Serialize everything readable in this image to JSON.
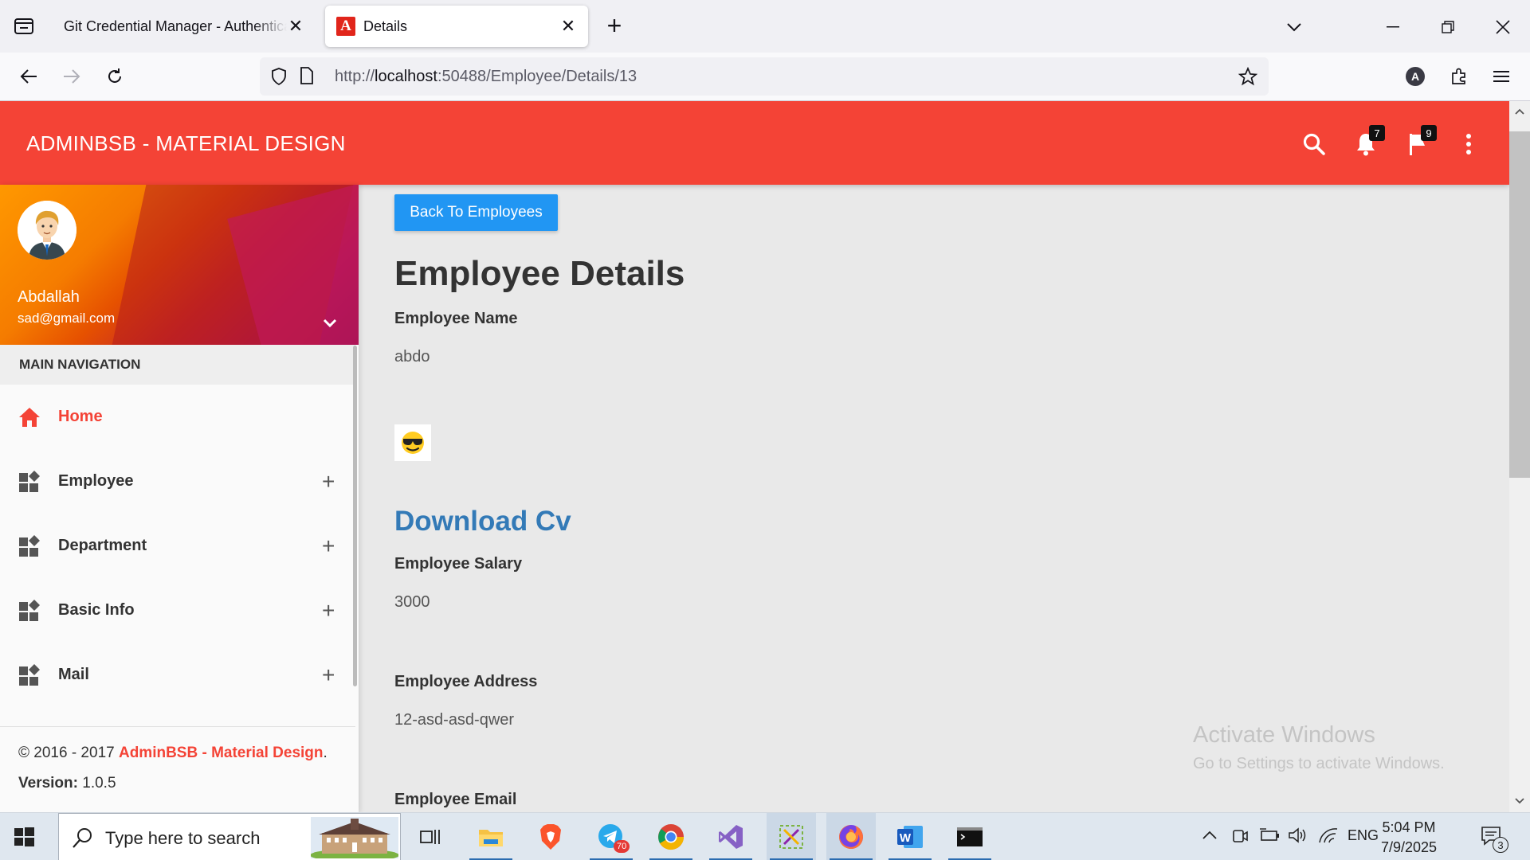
{
  "browser": {
    "tabs": [
      {
        "title": "Git Credential Manager - Authentication"
      },
      {
        "title": "Details"
      }
    ],
    "url_prefix": "http://",
    "url_host": "localhost",
    "url_path": ":50488/Employee/Details/13",
    "profile_initial": "A"
  },
  "topbar": {
    "brand": "ADMINBSB - MATERIAL DESIGN",
    "notifications_count": "7",
    "tasks_count": "9"
  },
  "sidebar": {
    "user_name": "Abdallah",
    "user_email": "sad@gmail.com",
    "nav_header": "MAIN NAVIGATION",
    "items": [
      {
        "label": "Home",
        "icon": "home-icon"
      },
      {
        "label": "Employee",
        "icon": "widgets-icon"
      },
      {
        "label": "Department",
        "icon": "widgets-icon"
      },
      {
        "label": "Basic Info",
        "icon": "widgets-icon"
      },
      {
        "label": "Mail",
        "icon": "widgets-icon"
      }
    ],
    "legal_prefix": "© 2016 - 2017 ",
    "legal_link": "AdminBSB - Material Design",
    "legal_suffix": ".",
    "version_label": "Version:",
    "version_value": " 1.0.5"
  },
  "main": {
    "back_button": "Back To Employees",
    "heading": "Employee Details",
    "fields": [
      {
        "label": "Employee Name",
        "value": "abdo"
      },
      {
        "label": "Employee Salary",
        "value": "3000"
      },
      {
        "label": "Employee Address",
        "value": "12-asd-asd-qwer"
      },
      {
        "label": "Employee Email",
        "value": ""
      }
    ],
    "download_link": "Download Cv"
  },
  "watermark": {
    "line1": "Activate Windows",
    "line2": "Go to Settings to activate Windows."
  },
  "taskbar": {
    "search_placeholder": "Type here to search",
    "telegram_badge": "70",
    "language": "ENG",
    "time": "5:04 PM",
    "date": "7/9/2025",
    "notification_count": "3"
  },
  "colors": {
    "accent": "#f44336",
    "primary_button": "#2196f3",
    "link": "#337ab7"
  }
}
